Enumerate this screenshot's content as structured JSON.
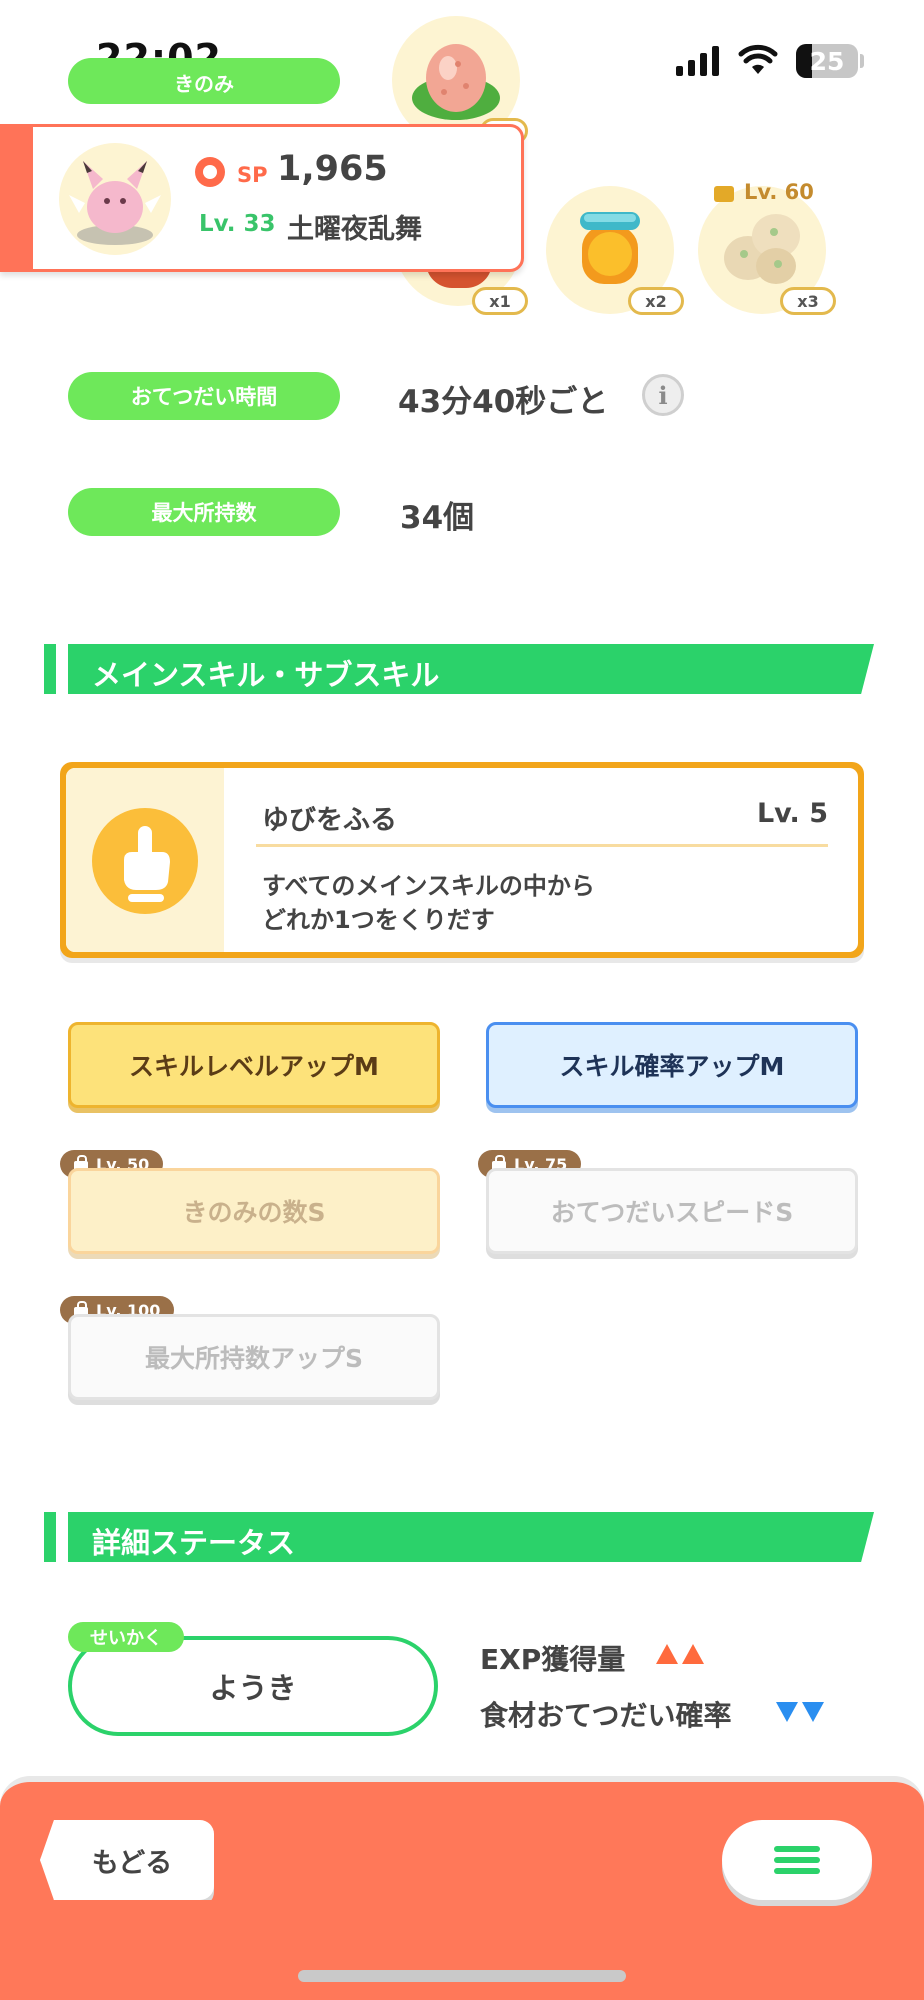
{
  "status_bar": {
    "time": "22:02",
    "battery": "25"
  },
  "berries": {
    "label": "きのみ"
  },
  "pokemon": {
    "sp_label": "SP",
    "sp_value": "1,965",
    "level": "Lv. 33",
    "name": "土曜夜乱舞"
  },
  "ingredients": [
    {
      "qty": "x1"
    },
    {
      "qty": "x2"
    },
    {
      "qty": "x3",
      "unlock": "Lv. 60"
    }
  ],
  "help_time": {
    "label": "おてつだい時間",
    "value": "43分40秒ごと"
  },
  "max_carry": {
    "label": "最大所持数",
    "value": "34個"
  },
  "skills_section": {
    "title": "メインスキル・サブスキル"
  },
  "main_skill": {
    "name": "ゆびをふる",
    "level": "Lv. 5",
    "desc_line1": "すべてのメインスキルの中から",
    "desc_line2": "どれか1つをくりだす"
  },
  "sub_skills": [
    {
      "label": "スキルレベルアップM"
    },
    {
      "label": "スキル確率アップM"
    },
    {
      "label": "きのみの数S",
      "lock": "Lv. 50"
    },
    {
      "label": "おてつだいスピードS",
      "lock": "Lv. 75"
    },
    {
      "label": "最大所持数アップS",
      "lock": "Lv. 100"
    }
  ],
  "details_section": {
    "title": "詳細ステータス"
  },
  "nature": {
    "tag": "せいかく",
    "value": "ようき",
    "up_label": "EXP獲得量",
    "down_label": "食材おてつだい確率"
  },
  "footer": {
    "back_label": "もどる"
  },
  "colors": {
    "green": "#2bd26a",
    "accent": "#ff7358",
    "gold": "#f2a51a"
  }
}
